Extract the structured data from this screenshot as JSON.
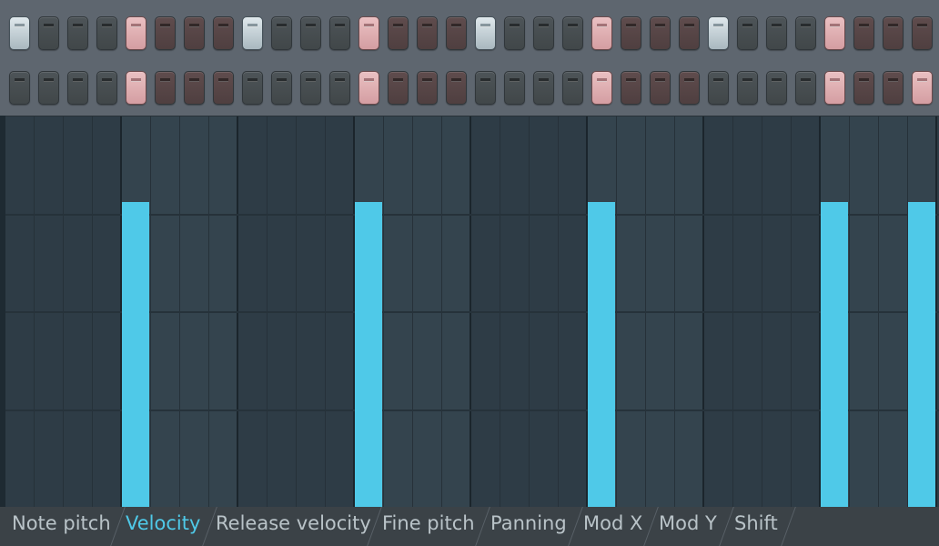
{
  "step_sequencer": {
    "rows": [
      {
        "name": "row-1",
        "states": [
          "accent",
          "off",
          "off",
          "off",
          "on",
          "off",
          "off",
          "off",
          "accent",
          "off",
          "off",
          "off",
          "on",
          "off",
          "off",
          "off",
          "accent",
          "off",
          "off",
          "off",
          "on",
          "off",
          "off",
          "off",
          "accent",
          "off",
          "off",
          "off",
          "on",
          "off",
          "off",
          "off"
        ]
      },
      {
        "name": "row-2",
        "states": [
          "off",
          "off",
          "off",
          "off",
          "on",
          "off",
          "off",
          "off",
          "off",
          "off",
          "off",
          "off",
          "on",
          "off",
          "off",
          "off",
          "off",
          "off",
          "off",
          "off",
          "on",
          "off",
          "off",
          "off",
          "off",
          "off",
          "off",
          "off",
          "on",
          "off",
          "off",
          "on"
        ]
      }
    ],
    "group_size": 4
  },
  "event_editor": {
    "active_property": "Velocity",
    "max_value": 128,
    "steps_visible": 33,
    "notes": [
      {
        "step": 5,
        "velocity": 100
      },
      {
        "step": 13,
        "velocity": 100
      },
      {
        "step": 21,
        "velocity": 100
      },
      {
        "step": 29,
        "velocity": 100
      },
      {
        "step": 32,
        "velocity": 100
      }
    ],
    "colors": {
      "bar": "#4fc9e8",
      "active_tab": "#4fc9e8"
    }
  },
  "tabs": [
    {
      "label": "Note pitch",
      "active": false
    },
    {
      "label": "Velocity",
      "active": true
    },
    {
      "label": "Release velocity",
      "active": false
    },
    {
      "label": "Fine pitch",
      "active": false
    },
    {
      "label": "Panning",
      "active": false
    },
    {
      "label": "Mod X",
      "active": false
    },
    {
      "label": "Mod Y",
      "active": false
    },
    {
      "label": "Shift",
      "active": false
    }
  ]
}
